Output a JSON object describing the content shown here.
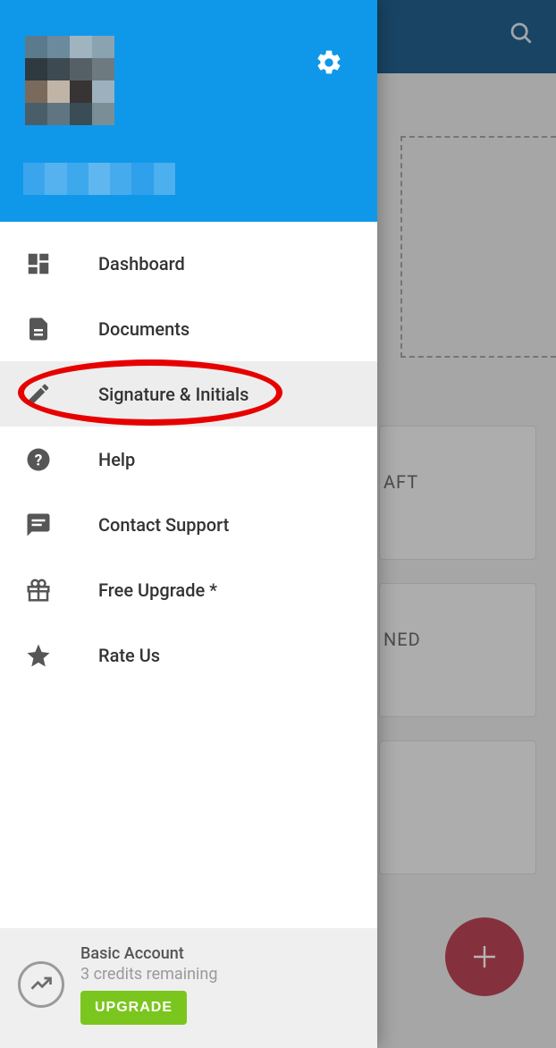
{
  "background": {
    "card1_label": "AFT",
    "card2_label": "NED"
  },
  "drawer": {
    "nav": [
      {
        "name": "dashboard",
        "label": "Dashboard",
        "icon": "dashboard-icon",
        "selected": false
      },
      {
        "name": "documents",
        "label": "Documents",
        "icon": "document-icon",
        "selected": false
      },
      {
        "name": "signature",
        "label": "Signature & Initials",
        "icon": "pencil-icon",
        "selected": true
      },
      {
        "name": "help",
        "label": "Help",
        "icon": "help-icon",
        "selected": false
      },
      {
        "name": "contact",
        "label": "Contact Support",
        "icon": "chat-icon",
        "selected": false
      },
      {
        "name": "upgrade",
        "label": "Free Upgrade *",
        "icon": "gift-icon",
        "selected": false
      },
      {
        "name": "rate",
        "label": "Rate Us",
        "icon": "star-icon",
        "selected": false
      }
    ],
    "footer": {
      "account_type": "Basic Account",
      "credits": "3 credits remaining",
      "upgrade_label": "UPGRADE"
    }
  },
  "colors": {
    "drawer_header": "#0f98e9",
    "topbar": "#0b4f80",
    "accent_green": "#7bc61e",
    "fab": "#b53144",
    "highlight": "#e60000"
  }
}
